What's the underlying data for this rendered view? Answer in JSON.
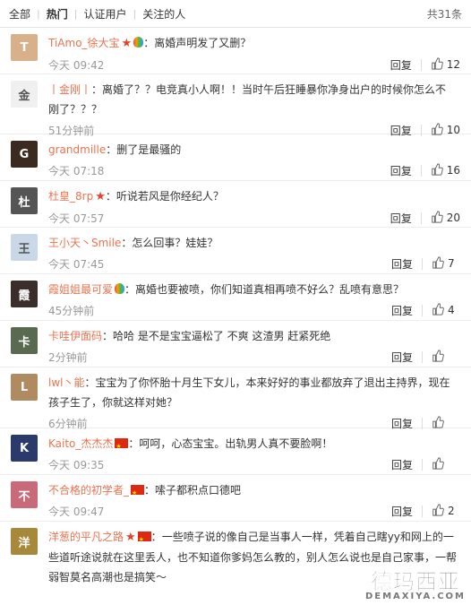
{
  "tabs": {
    "all": "全部",
    "hot": "热门",
    "verified": "认证用户",
    "following": "关注的人",
    "total": "共31条"
  },
  "reply_label": "回复",
  "comments": [
    {
      "name": "TiAmo_徐大宝",
      "badges": [
        "star",
        "bulb"
      ],
      "text": "离婚声明发了又删？",
      "time": "今天 09:42",
      "likes": "12",
      "avatar_color": "#d8b08a",
      "avatar_char": "T"
    },
    {
      "name": "丨金刚丨",
      "badges": [],
      "text": "离婚了？？电竞真小人啊！！当时午后狂睡暴你净身出户的时候你怎么不刚了？？？",
      "time": "51分钟前",
      "likes": "10",
      "avatar_color": "#f0f0f0",
      "avatar_char": "金"
    },
    {
      "name": "grandmille",
      "badges": [],
      "text": "删了是最骚的",
      "time": "今天 07:18",
      "likes": "16",
      "avatar_color": "#3a2a20",
      "avatar_char": "G"
    },
    {
      "name": "杜皇_8rp",
      "badges": [
        "star"
      ],
      "text": "听说若风是你经纪人？",
      "time": "今天 07:57",
      "likes": "20",
      "avatar_color": "#555555",
      "avatar_char": "杜"
    },
    {
      "name": "王小天丶Smile",
      "badges": [],
      "text": "怎么回事？娃娃？",
      "time": "今天 07:45",
      "likes": "7",
      "avatar_color": "#c9d7e6",
      "avatar_char": "王"
    },
    {
      "name": "霞姐姐最可爱",
      "badges": [
        "bulb"
      ],
      "text": "离婚也要被喷，你们知道真相再喷不好么？乱喷有意思？",
      "time": "45分钟前",
      "likes": "4",
      "avatar_color": "#3b2e2a",
      "avatar_char": "霞"
    },
    {
      "name": "卡哇伊面码",
      "badges": [],
      "text": "哈哈 是不是宝宝逼松了 不爽 这渣男 赶紧死绝",
      "time": "2分钟前",
      "likes": "",
      "avatar_color": "#5a6a50",
      "avatar_char": "卡"
    },
    {
      "name": "lwl丶能",
      "badges": [],
      "text": "宝宝为了你怀胎十月生下女儿，本来好好的事业都放弃了退出主持界，现在孩子生了，你就这样对她？",
      "time": "6分钟前",
      "likes": "",
      "avatar_color": "#b08a60",
      "avatar_char": "L"
    },
    {
      "name": "Kaito_杰杰杰",
      "badges": [
        "flag"
      ],
      "text": "呵呵，心态宝宝。出轨男人真不要脸啊！",
      "time": "今天 09:35",
      "likes": "",
      "avatar_color": "#2a3a6a",
      "avatar_char": "K"
    },
    {
      "name": "不合格的初学者_",
      "badges": [
        "flag"
      ],
      "text": "嗦子都积点口德吧",
      "time": "今天 09:47",
      "likes": "2",
      "avatar_color": "#c86a7a",
      "avatar_char": "不"
    },
    {
      "name": "洋葱的平凡之路",
      "badges": [
        "star",
        "flag"
      ],
      "text": "一些喷子说的像自己是当事人一样，凭着自己瞎yy和网上的一些道听途说就在这里丢人，也不知道你爹妈怎么教的，别人怎么说也是自己家事，一帮弱智莫名高潮也是搞笑～",
      "time": "",
      "likes": "",
      "avatar_color": "#a8883a",
      "avatar_char": "洋"
    }
  ],
  "watermark": {
    "main": "德玛西亚",
    "sub": "DEMAXIYA.COM"
  }
}
